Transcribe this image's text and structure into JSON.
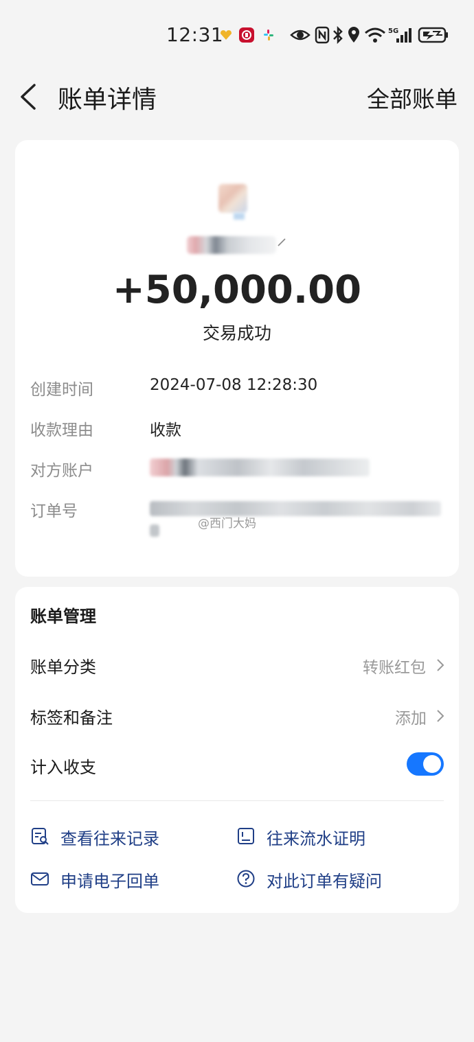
{
  "status_bar": {
    "time": "12:31",
    "network": "5G"
  },
  "nav": {
    "title": "账单详情",
    "right_link": "全部账单"
  },
  "transaction": {
    "amount": "+50,000.00",
    "status": "交易成功",
    "details": [
      {
        "label": "创建时间",
        "value": "2024-07-08 12:28:30"
      },
      {
        "label": "收款理由",
        "value": "收款"
      },
      {
        "label": "对方账户",
        "value": ""
      },
      {
        "label": "订单号",
        "value": ""
      }
    ]
  },
  "watermark": "@西门大妈",
  "manage": {
    "title": "账单管理",
    "rows": [
      {
        "label": "账单分类",
        "value": "转账红包"
      },
      {
        "label": "标签和备注",
        "value": "添加"
      },
      {
        "label": "计入收支",
        "value": ""
      }
    ],
    "include_in_stats": true,
    "actions": [
      {
        "label": "查看往来记录",
        "icon": "record-search-icon"
      },
      {
        "label": "往来流水证明",
        "icon": "statement-proof-icon"
      },
      {
        "label": "申请电子回单",
        "icon": "mail-icon"
      },
      {
        "label": "对此订单有疑问",
        "icon": "question-icon"
      }
    ]
  },
  "colors": {
    "accent": "#1677ff",
    "action_text": "#1f3e86",
    "background": "#f4f4f4"
  }
}
